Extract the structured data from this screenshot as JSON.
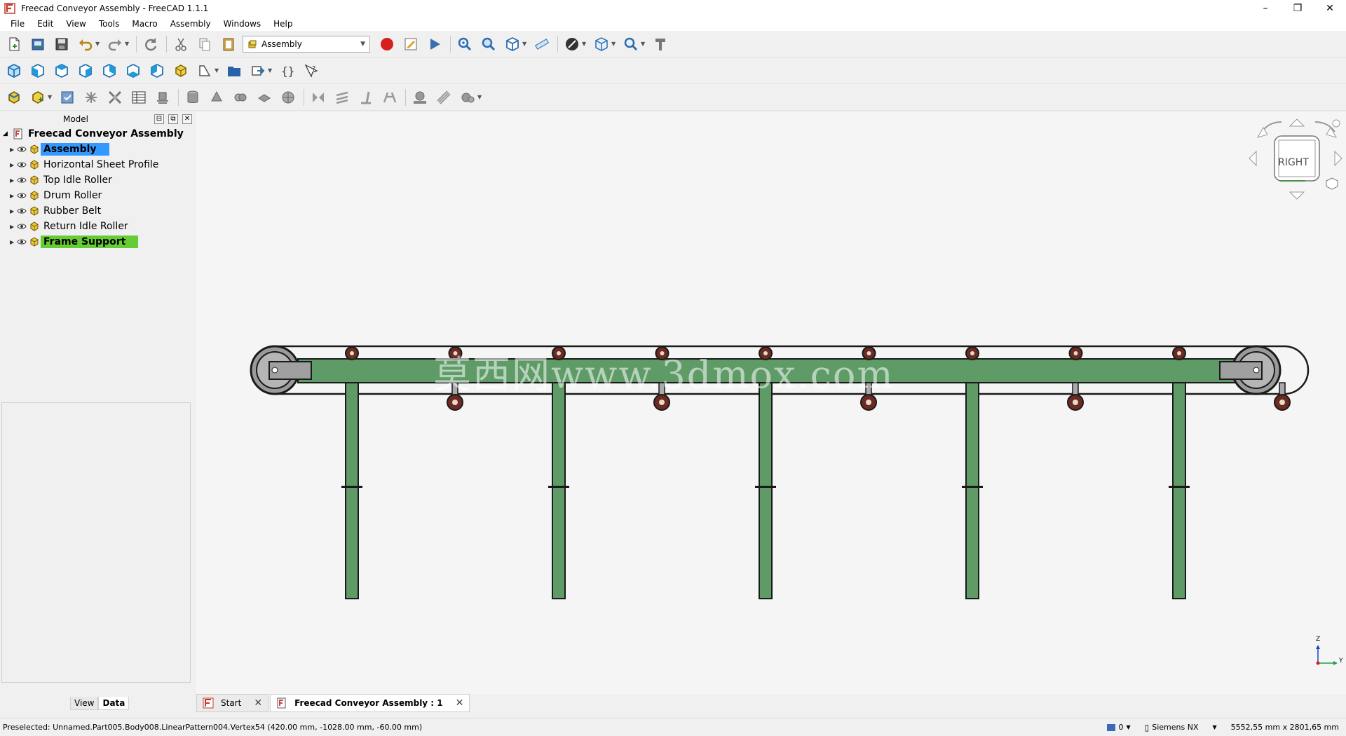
{
  "window": {
    "title": "Freecad Conveyor Assembly - FreeCAD 1.1.1",
    "controls": [
      "–",
      "❐",
      "✕"
    ]
  },
  "menu": [
    "File",
    "Edit",
    "View",
    "Tools",
    "Macro",
    "Assembly",
    "Windows",
    "Help"
  ],
  "workbench": {
    "selected": "Assembly"
  },
  "model_panel": {
    "title": "Model",
    "root": "Freecad Conveyor Assembly",
    "items": [
      {
        "label": "Assembly",
        "highlight": "blue"
      },
      {
        "label": "Horizontal Sheet Profile",
        "highlight": ""
      },
      {
        "label": "Top Idle Roller",
        "highlight": ""
      },
      {
        "label": "Drum Roller",
        "highlight": ""
      },
      {
        "label": "Rubber Belt",
        "highlight": ""
      },
      {
        "label": "Return Idle Roller",
        "highlight": ""
      },
      {
        "label": "Frame Support",
        "highlight": "green"
      }
    ],
    "tabs": [
      "View",
      "Data"
    ],
    "active_tab": "Data"
  },
  "viewport": {
    "watermark": "莫西网www.3dmox.com",
    "navcube_face": "RIGHT",
    "axis": {
      "z": "Z",
      "y": "Y"
    },
    "colors": {
      "frame": "#5e9b66",
      "outline": "#1a1a1a",
      "roller": "#6b2a22",
      "drum": "#9a9a9a",
      "bg": "#f5f5f5"
    }
  },
  "doc_tabs": [
    {
      "label": "Start",
      "active": false
    },
    {
      "label": "Freecad Conveyor Assembly : 1",
      "active": true
    }
  ],
  "status": {
    "message": "Preselected: Unnamed.Part005.Body008.LinearPattern004.Vertex54 (420.00 mm, -1028.00 mm, -60.00 mm)",
    "count": "0",
    "nav_style": "Siemens NX",
    "dimensions": "5552,55 mm x 2801,65 mm"
  }
}
